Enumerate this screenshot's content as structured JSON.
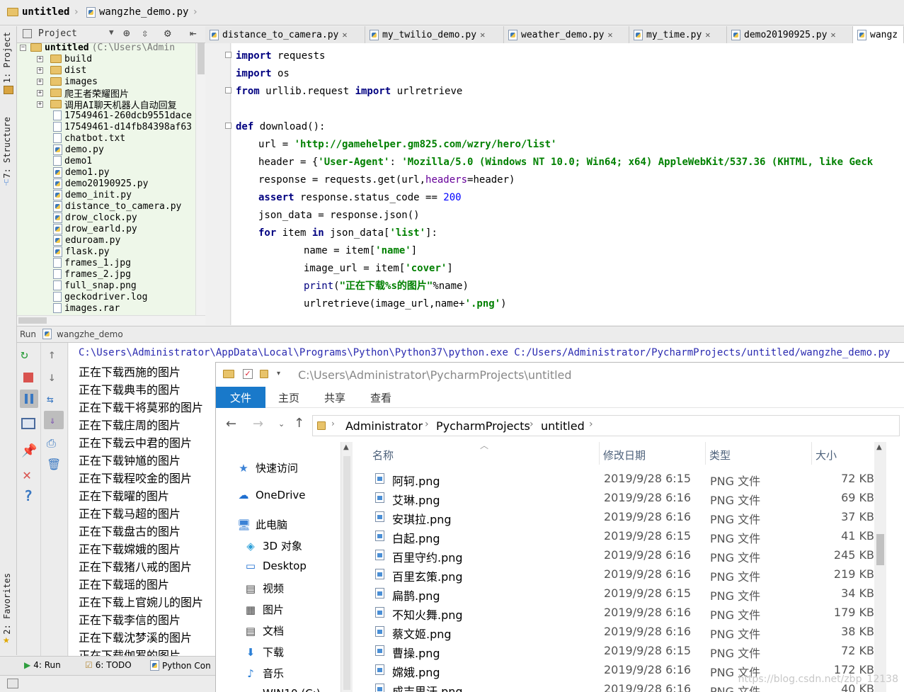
{
  "navbar": {
    "project": "untitled",
    "file": "wangzhe_demo.py"
  },
  "left_strip": {
    "project_tab": "1: Project",
    "structure_tab": "7: Structure",
    "favorites_tab": "2: Favorites"
  },
  "project_panel": {
    "header": "Project",
    "root": "untitled",
    "root_path": "(C:\\Users\\Admin",
    "items": [
      {
        "name": "build",
        "type": "folder"
      },
      {
        "name": "dist",
        "type": "folder"
      },
      {
        "name": "images",
        "type": "folder"
      },
      {
        "name": "爬王者荣耀图片",
        "type": "folder"
      },
      {
        "name": "调用AI聊天机器人自动回复",
        "type": "folder"
      },
      {
        "name": "17549461-260dcb9551dace",
        "type": "file"
      },
      {
        "name": "17549461-d14fb84398af63",
        "type": "file"
      },
      {
        "name": "chatbot.txt",
        "type": "file"
      },
      {
        "name": "demo.py",
        "type": "py"
      },
      {
        "name": "demo1",
        "type": "file"
      },
      {
        "name": "demo1.py",
        "type": "py"
      },
      {
        "name": "demo20190925.py",
        "type": "py"
      },
      {
        "name": "demo_init.py",
        "type": "py"
      },
      {
        "name": "distance_to_camera.py",
        "type": "py"
      },
      {
        "name": "drow_clock.py",
        "type": "py"
      },
      {
        "name": "drow_earld.py",
        "type": "py"
      },
      {
        "name": "eduroam.py",
        "type": "py"
      },
      {
        "name": "flask.py",
        "type": "py"
      },
      {
        "name": "frames_1.jpg",
        "type": "file"
      },
      {
        "name": "frames_2.jpg",
        "type": "file"
      },
      {
        "name": "full_snap.png",
        "type": "file"
      },
      {
        "name": "geckodriver.log",
        "type": "file"
      },
      {
        "name": "images.rar",
        "type": "file"
      }
    ]
  },
  "editor_tabs": [
    "distance_to_camera.py",
    "my_twilio_demo.py",
    "weather_demo.py",
    "my_time.py",
    "demo20190925.py",
    "wangz"
  ],
  "code": {
    "l1": [
      "import",
      " requests"
    ],
    "l2": [
      "import",
      " os"
    ],
    "l3": [
      "from",
      " urllib.request ",
      "import",
      " urlretrieve"
    ],
    "l5": [
      "def",
      " download():"
    ],
    "l6": [
      "url = ",
      "'http://gamehelper.gm825.com/wzry/hero/list'"
    ],
    "l7": [
      "header = {",
      "'User-Agent'",
      ": ",
      "'Mozilla/5.0 (Windows NT 10.0; Win64; x64) AppleWebKit/537.36 (KHTML, like Geck"
    ],
    "l8": [
      "response = requests.get(url,",
      "headers",
      "=header)"
    ],
    "l9": [
      "assert",
      " response.status_code == ",
      "200"
    ],
    "l10": [
      "json_data = response.json()"
    ],
    "l11": [
      "for",
      " item ",
      "in",
      " json_data[",
      "'list'",
      "]:"
    ],
    "l12": [
      "name = item[",
      "'name'",
      "]"
    ],
    "l13": [
      "image_url = item[",
      "'cover'",
      "]"
    ],
    "l14": [
      "print",
      "(",
      "\"正在下载%s的图片\"",
      "%name)"
    ],
    "l15": [
      "urlretrieve(image_url,name+",
      "'.png'",
      ")"
    ]
  },
  "run_panel": {
    "label": "Run",
    "config": "wangzhe_demo",
    "command": "C:\\Users\\Administrator\\AppData\\Local\\Programs\\Python\\Python37\\python.exe C:/Users/Administrator/PycharmProjects/untitled/wangzhe_demo.py",
    "output": [
      "正在下载西施的图片",
      "正在下载典韦的图片",
      "正在下载干将莫邪的图片",
      "正在下载庄周的图片",
      "正在下载云中君的图片",
      "正在下载钟馗的图片",
      "正在下载程咬金的图片",
      "正在下载曜的图片",
      "正在下载马超的图片",
      "正在下载盘古的图片",
      "正在下载嫦娥的图片",
      "正在下载猪八戒的图片",
      "正在下载瑶的图片",
      "正在下载上官婉儿的图片",
      "正在下载李信的图片",
      "正在下载沈梦溪的图片",
      "正在下载伽罗的图片"
    ]
  },
  "bottom_tabs": {
    "run": "4: Run",
    "todo": "6: TODO",
    "console": "Python Con"
  },
  "explorer": {
    "title_path": "C:\\Users\\Administrator\\PycharmProjects\\untitled",
    "ribbon": [
      "文件",
      "主页",
      "共享",
      "查看"
    ],
    "breadcrumb": [
      "Administrator",
      "PycharmProjects",
      "untitled"
    ],
    "nav": [
      {
        "label": "快速访问",
        "icon": "star-icon"
      },
      {
        "label": "OneDrive",
        "icon": "cloud-icon"
      },
      {
        "label": "此电脑",
        "icon": "computer-icon"
      },
      {
        "label": "3D 对象",
        "icon": "cube-icon"
      },
      {
        "label": "Desktop",
        "icon": "desktop-icon"
      },
      {
        "label": "视频",
        "icon": "video-icon"
      },
      {
        "label": "图片",
        "icon": "picture-icon"
      },
      {
        "label": "文档",
        "icon": "document-icon"
      },
      {
        "label": "下载",
        "icon": "download-icon"
      },
      {
        "label": "音乐",
        "icon": "music-icon"
      },
      {
        "label": "WIN10 (C:)",
        "icon": "drive-icon"
      }
    ],
    "columns": [
      "名称",
      "修改日期",
      "类型",
      "大小"
    ],
    "files": [
      {
        "name": "阿轲.png",
        "date": "2019/9/28 6:15",
        "type": "PNG 文件",
        "size": "72 KB"
      },
      {
        "name": "艾琳.png",
        "date": "2019/9/28 6:16",
        "type": "PNG 文件",
        "size": "69 KB"
      },
      {
        "name": "安琪拉.png",
        "date": "2019/9/28 6:16",
        "type": "PNG 文件",
        "size": "37 KB"
      },
      {
        "name": "白起.png",
        "date": "2019/9/28 6:15",
        "type": "PNG 文件",
        "size": "41 KB"
      },
      {
        "name": "百里守约.png",
        "date": "2019/9/28 6:16",
        "type": "PNG 文件",
        "size": "245 KB"
      },
      {
        "name": "百里玄策.png",
        "date": "2019/9/28 6:16",
        "type": "PNG 文件",
        "size": "219 KB"
      },
      {
        "name": "扁鹊.png",
        "date": "2019/9/28 6:15",
        "type": "PNG 文件",
        "size": "34 KB"
      },
      {
        "name": "不知火舞.png",
        "date": "2019/9/28 6:16",
        "type": "PNG 文件",
        "size": "179 KB"
      },
      {
        "name": "蔡文姬.png",
        "date": "2019/9/28 6:16",
        "type": "PNG 文件",
        "size": "38 KB"
      },
      {
        "name": "曹操.png",
        "date": "2019/9/28 6:15",
        "type": "PNG 文件",
        "size": "72 KB"
      },
      {
        "name": "嫦娥.png",
        "date": "2019/9/28 6:16",
        "type": "PNG 文件",
        "size": "172 KB"
      },
      {
        "name": "成吉思汗.png",
        "date": "2019/9/28 6:16",
        "type": "PNG 文件",
        "size": "40 KB"
      }
    ],
    "watermark": "https://blog.csdn.net/zbp_12138"
  }
}
